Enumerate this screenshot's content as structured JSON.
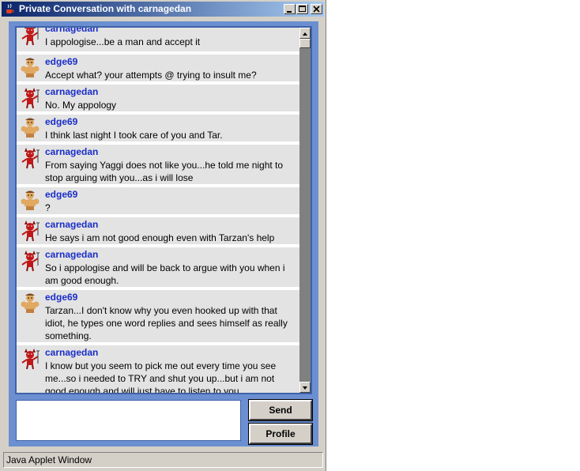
{
  "window": {
    "title": "Private Conversation with carnagedan",
    "status_text": "Java Applet Window"
  },
  "colors": {
    "title_start": "#0a246a",
    "panel": "#6b8fd0",
    "username": "#1a2ec8"
  },
  "messages": [
    {
      "user": "carnagedan",
      "avatar": "devil-avatar-icon",
      "text": "I appologise...be a man and accept it"
    },
    {
      "user": "edge69",
      "avatar": "muscleman-avatar-icon",
      "text": "Accept what? your attempts @ trying to insult me?"
    },
    {
      "user": "carnagedan",
      "avatar": "devil-avatar-icon",
      "text": "No. My appology"
    },
    {
      "user": "edge69",
      "avatar": "muscleman-avatar-icon",
      "text": "I think last night I took care of you and Tar."
    },
    {
      "user": "carnagedan",
      "avatar": "devil-avatar-icon",
      "text": "From saying Yaggi does not like you...he told me  night to stop arguing with you...as i will lose"
    },
    {
      "user": "edge69",
      "avatar": "muscleman-avatar-icon",
      "text": "?"
    },
    {
      "user": "carnagedan",
      "avatar": "devil-avatar-icon",
      "text": "He says i am not good enough even with Tarzan's help"
    },
    {
      "user": "carnagedan",
      "avatar": "devil-avatar-icon",
      "text": "So i appologise and will be back to argue with you when i am good enough."
    },
    {
      "user": "edge69",
      "avatar": "muscleman-avatar-icon",
      "text": "Tarzan...I don't know why you even hooked up with that idiot, he types one word replies and sees himself as really something."
    },
    {
      "user": "carnagedan",
      "avatar": "devil-avatar-icon",
      "text": "I know but you seem to pick me out every time you see me...so i needed to TRY and shut you up...but i am not good enough and will just have to listen to you"
    }
  ],
  "compose": {
    "value": "",
    "send_label": "Send",
    "profile_label": "Profile"
  }
}
